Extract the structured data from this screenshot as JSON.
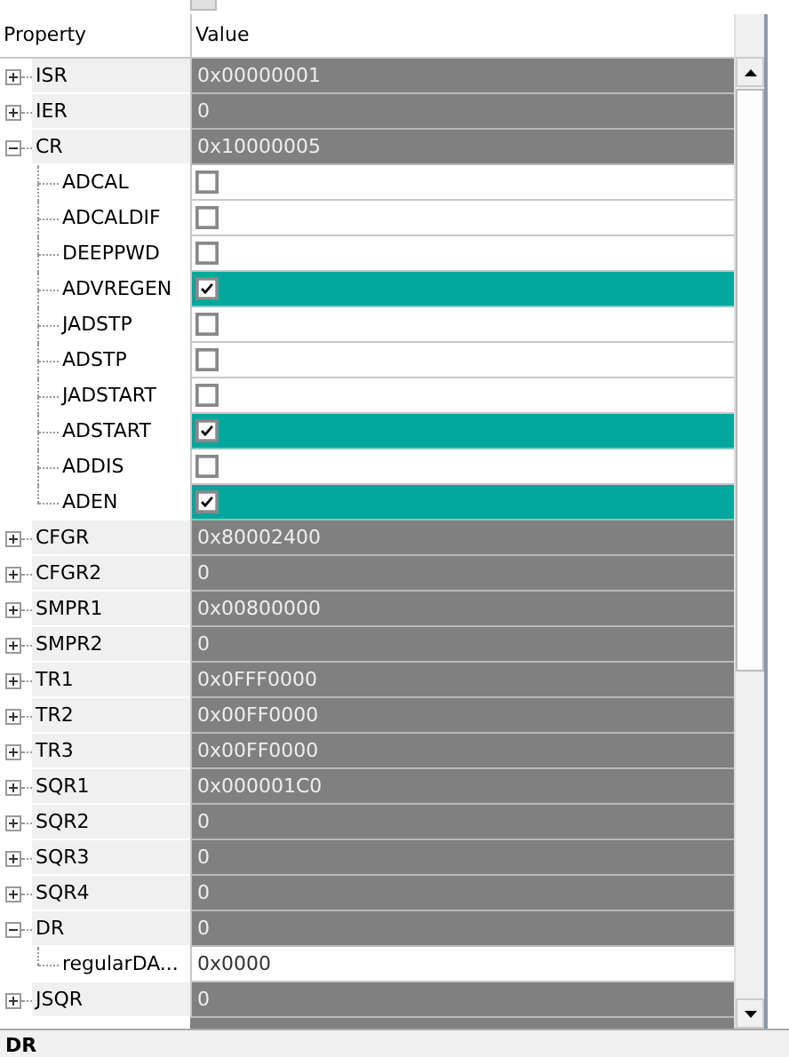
{
  "columns": [
    "Property",
    "Value"
  ],
  "rows": [
    {
      "kind": "register",
      "name": "ISR",
      "value": "0x00000001",
      "expanded": false
    },
    {
      "kind": "register",
      "name": "IER",
      "value": "0",
      "expanded": false
    },
    {
      "kind": "register",
      "name": "CR",
      "value": "0x10000005",
      "expanded": true,
      "children": [
        {
          "kind": "bit",
          "name": "ADCAL",
          "checked": false
        },
        {
          "kind": "bit",
          "name": "ADCALDIF",
          "checked": false
        },
        {
          "kind": "bit",
          "name": "DEEPPWD",
          "checked": false
        },
        {
          "kind": "bit",
          "name": "ADVREGEN",
          "checked": true
        },
        {
          "kind": "bit",
          "name": "JADSTP",
          "checked": false
        },
        {
          "kind": "bit",
          "name": "ADSTP",
          "checked": false
        },
        {
          "kind": "bit",
          "name": "JADSTART",
          "checked": false
        },
        {
          "kind": "bit",
          "name": "ADSTART",
          "checked": true
        },
        {
          "kind": "bit",
          "name": "ADDIS",
          "checked": false
        },
        {
          "kind": "bit",
          "name": "ADEN",
          "checked": true
        }
      ]
    },
    {
      "kind": "register",
      "name": "CFGR",
      "value": "0x80002400",
      "expanded": false
    },
    {
      "kind": "register",
      "name": "CFGR2",
      "value": "0",
      "expanded": false
    },
    {
      "kind": "register",
      "name": "SMPR1",
      "value": "0x00800000",
      "expanded": false
    },
    {
      "kind": "register",
      "name": "SMPR2",
      "value": "0",
      "expanded": false
    },
    {
      "kind": "register",
      "name": "TR1",
      "value": "0x0FFF0000",
      "expanded": false
    },
    {
      "kind": "register",
      "name": "TR2",
      "value": "0x00FF0000",
      "expanded": false
    },
    {
      "kind": "register",
      "name": "TR3",
      "value": "0x00FF0000",
      "expanded": false
    },
    {
      "kind": "register",
      "name": "SQR1",
      "value": "0x000001C0",
      "expanded": false
    },
    {
      "kind": "register",
      "name": "SQR2",
      "value": "0",
      "expanded": false
    },
    {
      "kind": "register",
      "name": "SQR3",
      "value": "0",
      "expanded": false
    },
    {
      "kind": "register",
      "name": "SQR4",
      "value": "0",
      "expanded": false
    },
    {
      "kind": "register",
      "name": "DR",
      "value": "0",
      "expanded": true,
      "children": [
        {
          "kind": "field",
          "name": "regularDA...",
          "value": "0x0000"
        }
      ]
    },
    {
      "kind": "register",
      "name": "JSQR",
      "value": "0",
      "expanded": false
    }
  ],
  "description": {
    "title": "DR"
  }
}
